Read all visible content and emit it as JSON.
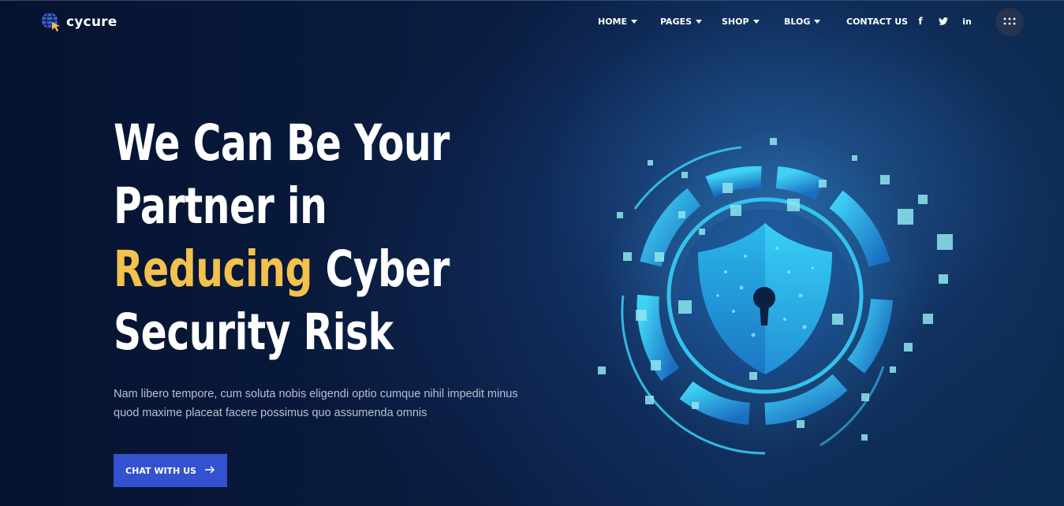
{
  "brand": {
    "name": "cycure",
    "icon": "globe-cursor-icon"
  },
  "nav": {
    "items": [
      {
        "label": "HOME",
        "has_dropdown": true
      },
      {
        "label": "PAGES",
        "has_dropdown": true
      },
      {
        "label": "SHOP",
        "has_dropdown": true
      },
      {
        "label": "BLOG",
        "has_dropdown": true
      },
      {
        "label": "CONTACT US",
        "has_dropdown": false
      }
    ],
    "social": [
      {
        "icon": "facebook-icon",
        "glyph": "f"
      },
      {
        "icon": "twitter-icon",
        "glyph": "t"
      },
      {
        "icon": "linkedin-icon",
        "glyph": "in"
      }
    ],
    "menu_icon": "grid-dots-icon"
  },
  "hero": {
    "headline_line1": "We Can Be Your",
    "headline_line2": "Partner in",
    "headline_accent": "Reducing",
    "headline_line3_rest": " Cyber",
    "headline_line4": "Security Risk",
    "description_line1": "Nam libero tempore, cum soluta nobis eligendi optio cumque nihil impedit minus",
    "description_line2": "quod maxime placeat facere possimus quo assumenda omnis",
    "cta_label": "CHAT WITH US",
    "cta_icon": "arrow-right-icon",
    "illustration": "shield-lock-icon"
  },
  "colors": {
    "accent": "#f2c14e",
    "button": "#3352d0",
    "background": "#071530",
    "illustration": "#35c8f0"
  }
}
